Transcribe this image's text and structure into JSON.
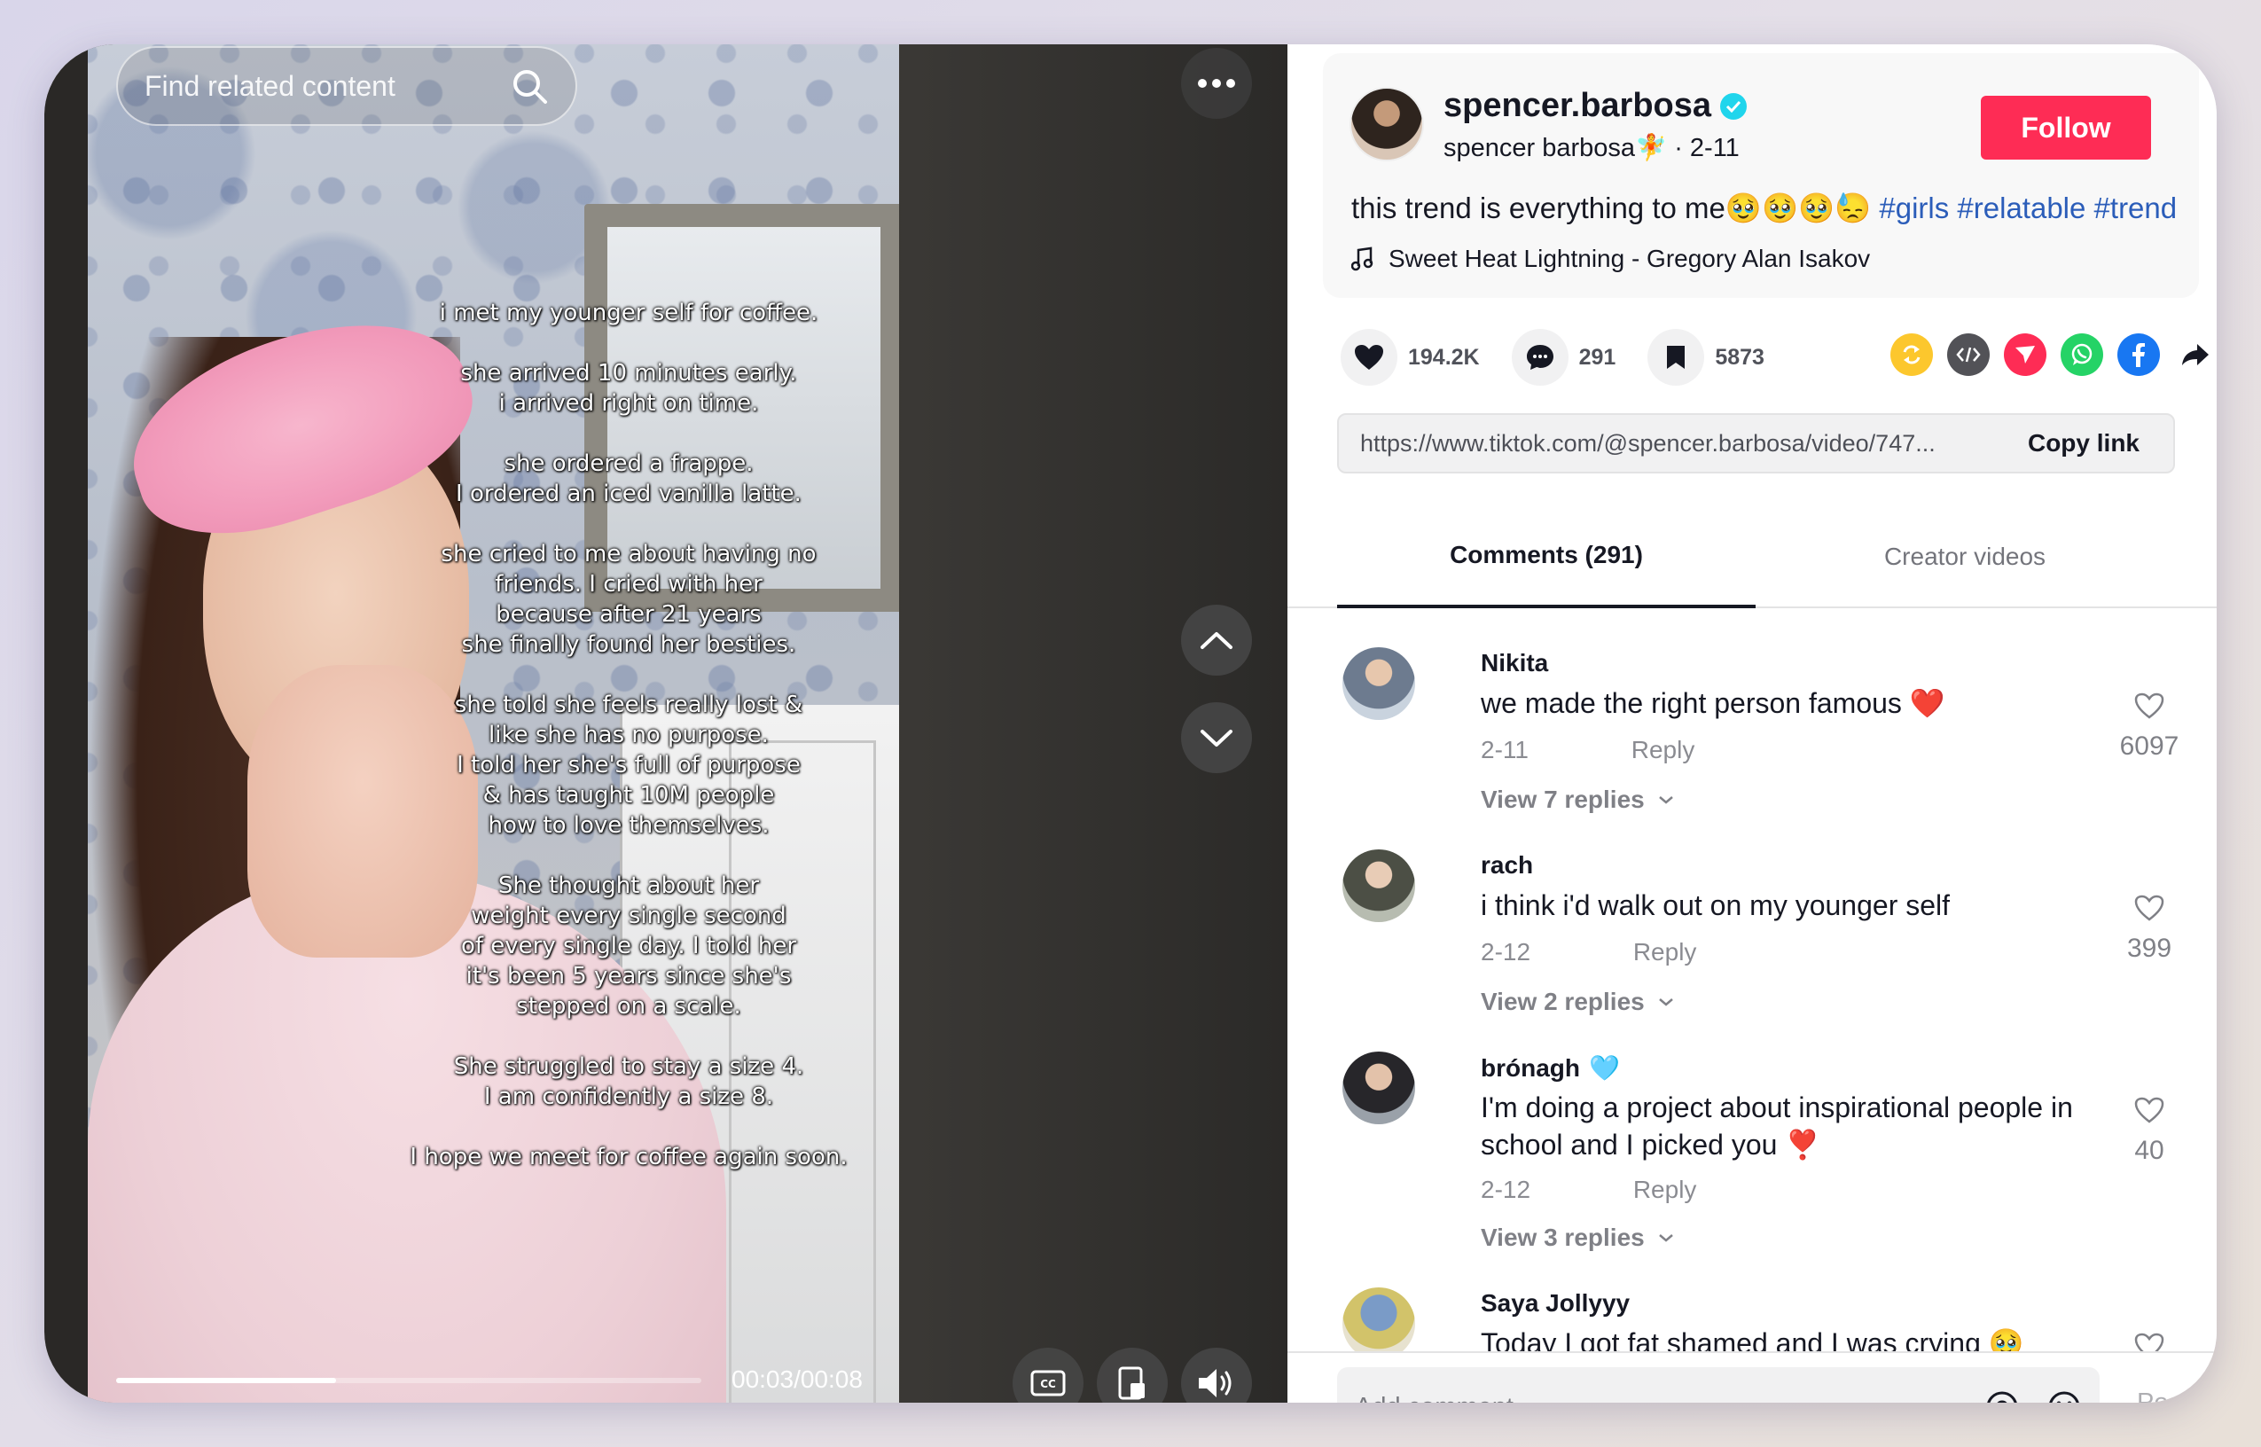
{
  "video": {
    "search_placeholder": "Find related content",
    "overlay_text": "i met my younger self for coffee.\n\nshe arrived 10 minutes early.\ni arrived right on time.\n\nshe ordered a frappe.\nI ordered an iced vanilla latte.\n\nshe cried to me about having no\nfriends. I cried with her\nbecause after 21 years\nshe finally found her besties.\n\nshe told she feels really lost &\nlike she has no purpose.\nI told her she's full of purpose\n& has taught 10M people\nhow to love themselves.\n\nShe thought about her\nweight every single second\nof every single day. I told her\nit's been 5 years since she's\nstepped on a scale.\n\nShe struggled to stay a size 4.\nI am confidently a size 8.\n\nI hope we meet for coffee again soon.",
    "time": "00:03/00:08",
    "progress": 0.375,
    "icons": [
      "search-icon",
      "more-icon",
      "chevron-up-icon",
      "chevron-down-icon",
      "captions-icon",
      "floating-player-icon",
      "volume-icon"
    ]
  },
  "post": {
    "username": "spencer.barbosa",
    "display_name": "spencer barbosa🧚",
    "date": "2-11",
    "follow_label": "Follow",
    "caption_text": "this trend is everything to me🥹🥹🥹😓",
    "hashtags": [
      "#girls",
      "#relatable",
      "#trend"
    ],
    "music": "Sweet Heat Lightning - Gregory Alan Isakov",
    "likes": "194.2K",
    "comments_count": "291",
    "saves": "5873",
    "link": "https://www.tiktok.com/@spencer.barbosa/video/747...",
    "copy_label": "Copy link"
  },
  "colors": {
    "brand_red": "#fe2c55",
    "hashtag_blue": "#2b5db9",
    "verified": "#20d5ec"
  },
  "tabs": {
    "comments": "Comments (291)",
    "creator": "Creator videos"
  },
  "comments": [
    {
      "user": "Nikita",
      "text": "we made the right person famous ❤️",
      "date": "2-11",
      "reply": "Reply",
      "likes": "6097",
      "replies": "View 7 replies"
    },
    {
      "user": "rach",
      "text": "i think i'd walk out on my younger self",
      "date": "2-12",
      "reply": "Reply",
      "likes": "399",
      "replies": "View 2 replies"
    },
    {
      "user": "brónagh",
      "badge": "🩵",
      "text": "I'm doing a project about inspirational people in school and I picked you ❣️",
      "date": "2-12",
      "reply": "Reply",
      "likes": "40",
      "replies": "View 3 replies"
    },
    {
      "user": "Saya Jollyyy",
      "text": "Today I got fat shamed and I was crying 🥹"
    }
  ],
  "composer": {
    "placeholder": "Add comment...",
    "post_label": "Post"
  }
}
